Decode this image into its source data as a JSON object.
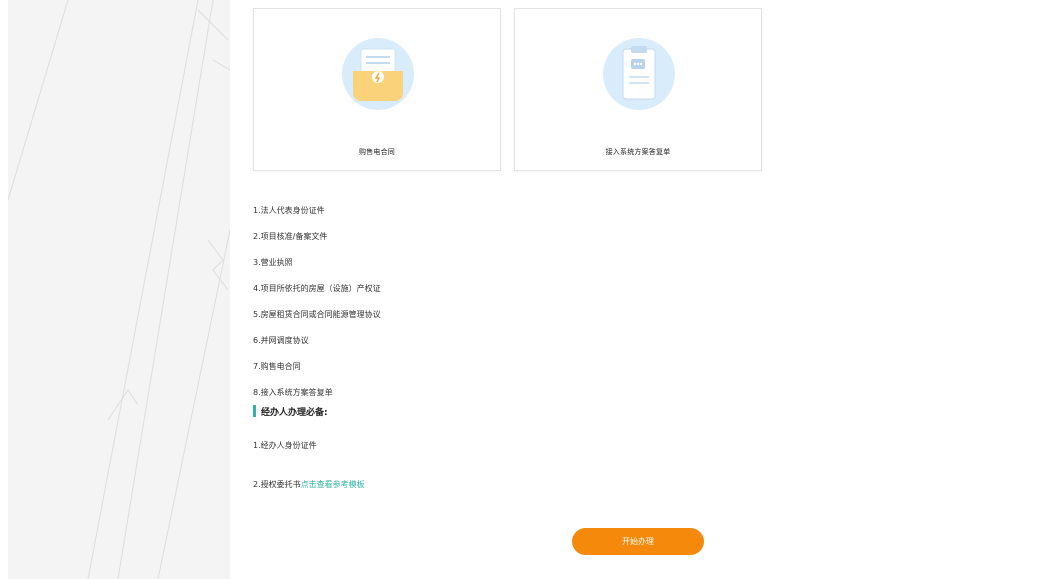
{
  "cards": [
    {
      "caption": "购售电合同",
      "icon": "contract-lightning-icon"
    },
    {
      "caption": "接入系统方案答复单",
      "icon": "clipboard-message-icon"
    }
  ],
  "requirements": [
    "1.法人代表身份证件",
    "2.项目核准/备案文件",
    "3.营业执照",
    "4.项目所依托的房屋（设施）产权证",
    "5.房屋租赁合同或合同能源管理协议",
    "6.并网调度协议",
    "7.购售电合同",
    "8.接入系统方案答复单"
  ],
  "agent_section": {
    "title": "经办人办理必备:",
    "items": [
      {
        "text": "1.经办人身份证件",
        "link": ""
      },
      {
        "text": "2.授权委托书",
        "link": "点击查看参考模板"
      }
    ]
  },
  "start_button": {
    "label": "开始办理"
  },
  "colors": {
    "accent_teal": "#2fb3a4",
    "button_orange": "#f5890b",
    "icon_circle_blue": "#d9ecfb",
    "icon_folder_yellow": "#f9d27a"
  }
}
